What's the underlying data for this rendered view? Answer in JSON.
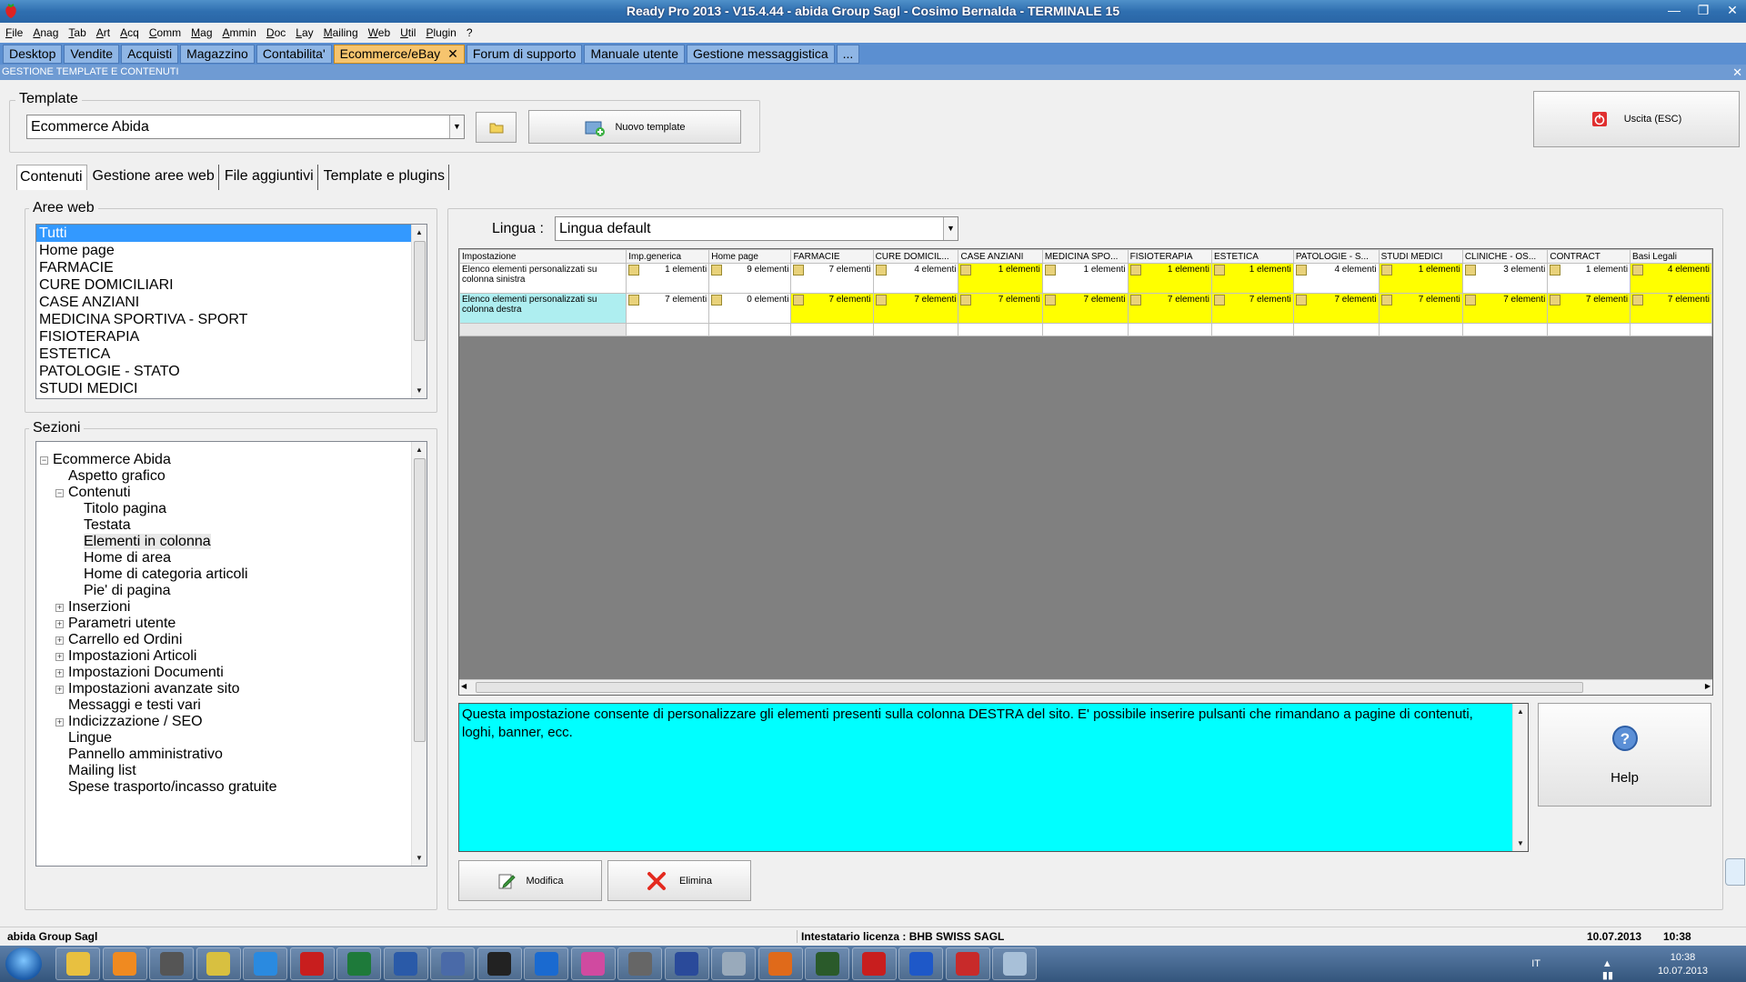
{
  "window": {
    "title": "Ready Pro 2013 - V15.4.44 - abida Group Sagl - Cosimo Bernalda - TERMINALE 15"
  },
  "menu": [
    "File",
    "Anag",
    "Tab",
    "Art",
    "Acq",
    "Comm",
    "Mag",
    "Ammin",
    "Doc",
    "Lay",
    "Mailing",
    "Web",
    "Util",
    "Plugin",
    "?"
  ],
  "app_tabs": [
    {
      "label": "Desktop"
    },
    {
      "label": "Vendite"
    },
    {
      "label": "Acquisti"
    },
    {
      "label": "Magazzino"
    },
    {
      "label": "Contabilita'"
    },
    {
      "label": "Ecommerce/eBay",
      "active": true
    },
    {
      "label": "Forum di supporto"
    },
    {
      "label": "Manuale utente"
    },
    {
      "label": "Gestione messaggistica"
    },
    {
      "label": "..."
    }
  ],
  "section_title": "GESTIONE TEMPLATE E CONTENUTI",
  "template": {
    "group_label": "Template",
    "selected": "Ecommerce Abida",
    "new_button": "Nuovo template",
    "exit_button": "Uscita (ESC)"
  },
  "subtabs": [
    "Contenuti",
    "Gestione aree web",
    "File aggiuntivi",
    "Template e plugins"
  ],
  "aree_web": {
    "label": "Aree web",
    "items": [
      "Tutti",
      "Home page",
      "FARMACIE",
      "CURE DOMICILIARI",
      "CASE ANZIANI",
      "MEDICINA SPORTIVA - SPORT",
      "FISIOTERAPIA",
      "ESTETICA",
      "PATOLOGIE - STATO",
      "STUDI MEDICI"
    ]
  },
  "sezioni": {
    "label": "Sezioni",
    "nodes": [
      {
        "label": "Ecommerce Abida",
        "level": 0,
        "exp": "-"
      },
      {
        "label": "Aspetto grafico",
        "level": 1
      },
      {
        "label": "Contenuti",
        "level": 1,
        "exp": "-"
      },
      {
        "label": "Titolo pagina",
        "level": 2
      },
      {
        "label": "Testata",
        "level": 2
      },
      {
        "label": "Elementi in colonna",
        "level": 2,
        "hl": true
      },
      {
        "label": "Home di area",
        "level": 2
      },
      {
        "label": "Home di categoria articoli",
        "level": 2
      },
      {
        "label": "Pie' di pagina",
        "level": 2
      },
      {
        "label": "Inserzioni",
        "level": 1,
        "exp": "+"
      },
      {
        "label": "Parametri utente",
        "level": 1,
        "exp": "+"
      },
      {
        "label": "Carrello ed Ordini",
        "level": 1,
        "exp": "+"
      },
      {
        "label": "Impostazioni Articoli",
        "level": 1,
        "exp": "+"
      },
      {
        "label": "Impostazioni Documenti",
        "level": 1,
        "exp": "+"
      },
      {
        "label": "Impostazioni avanzate sito",
        "level": 1,
        "exp": "+"
      },
      {
        "label": "Messaggi e testi vari",
        "level": 1
      },
      {
        "label": "Indicizzazione / SEO",
        "level": 1,
        "exp": "+"
      },
      {
        "label": "Lingue",
        "level": 1
      },
      {
        "label": "Pannello amministrativo",
        "level": 1
      },
      {
        "label": "Mailing list",
        "level": 1
      },
      {
        "label": "Spese trasporto/incasso gratuite",
        "level": 1
      }
    ]
  },
  "lingua": {
    "label": "Lingua :",
    "selected": "Lingua default"
  },
  "grid": {
    "columns": [
      "Impostazione",
      "Imp.generica",
      "Home page",
      "FARMACIE",
      "CURE DOMICIL...",
      "CASE ANZIANI",
      "MEDICINA SPO...",
      "FISIOTERAPIA",
      "ESTETICA",
      "PATOLOGIE - S...",
      "STUDI MEDICI",
      "CLINICHE - OS...",
      "CONTRACT",
      "Basi Legali"
    ],
    "rows": [
      {
        "label": "Elenco elementi personalizzati su colonna sinistra",
        "cells": [
          "1 elementi",
          "9 elementi",
          "7 elementi",
          "4 elementi",
          "1 elementi",
          "1 elementi",
          "1 elementi",
          "1 elementi",
          "4 elementi",
          "1 elementi",
          "3 elementi",
          "1 elementi",
          "4 elementi"
        ],
        "yellow": [
          false,
          false,
          false,
          false,
          true,
          false,
          true,
          true,
          false,
          true,
          false,
          false,
          true
        ]
      },
      {
        "label": "Elenco elementi personalizzati su colonna destra",
        "cells": [
          "7 elementi",
          "0 elementi",
          "7 elementi",
          "7 elementi",
          "7 elementi",
          "7 elementi",
          "7 elementi",
          "7 elementi",
          "7 elementi",
          "7 elementi",
          "7 elementi",
          "7 elementi",
          "7 elementi"
        ],
        "yellow": [
          false,
          false,
          true,
          true,
          true,
          true,
          true,
          true,
          true,
          true,
          true,
          true,
          true
        ]
      }
    ]
  },
  "description": "Questa impostazione consente di personalizzare gli elementi presenti sulla colonna DESTRA del sito. E' possibile inserire pulsanti che rimandano a pagine di contenuti, loghi, banner, ecc.",
  "help_label": "Help",
  "actions": {
    "modify": "Modifica",
    "delete": "Elimina"
  },
  "status": {
    "company": "abida Group Sagl",
    "license": "Intestatario licenza : BHB SWISS SAGL",
    "date": "10.07.2013",
    "time": "10:38"
  },
  "tray": {
    "lang": "IT",
    "time": "10:38",
    "date": "10.07.2013"
  },
  "taskbar_apps": [
    "folder",
    "media-player",
    "hp",
    "tools",
    "chrome",
    "filezilla",
    "excel",
    "word",
    "network",
    "pm",
    "teamviewer",
    "picasa",
    "gimp",
    "wireshark",
    "cube",
    "firefox",
    "terminal",
    "acrobat",
    "winscp",
    "strawberry",
    "paint"
  ]
}
